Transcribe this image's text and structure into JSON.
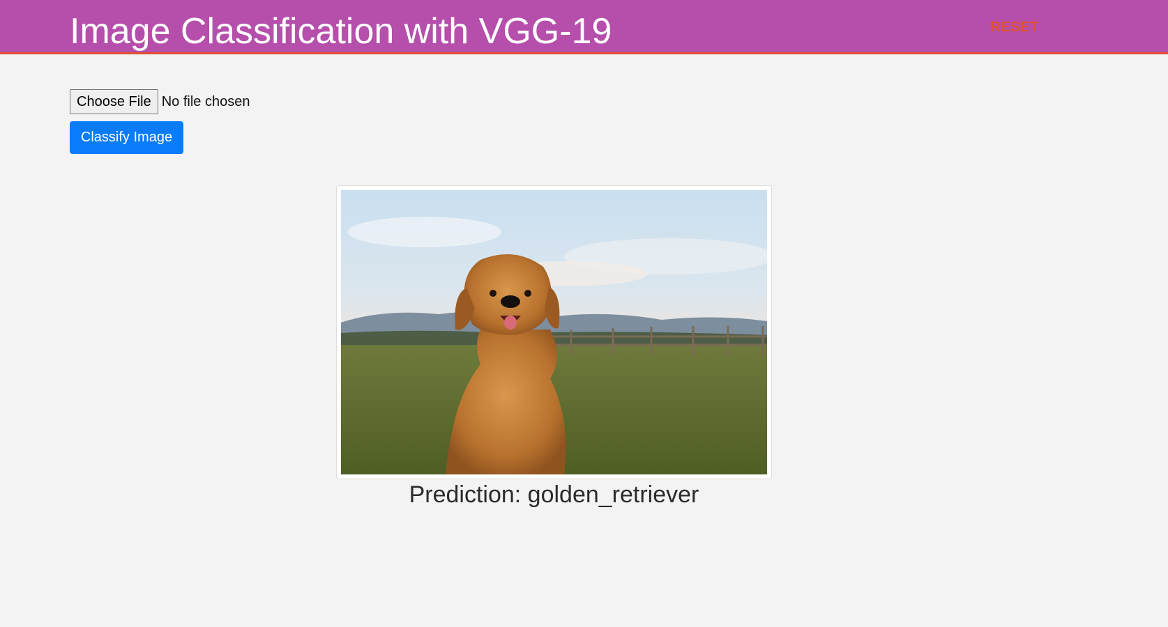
{
  "header": {
    "title": "Image Classification with VGG-19",
    "reset_label": "RESET",
    "background_color": "#b54fab",
    "accent_color": "#e2502d"
  },
  "upload": {
    "choose_file_label": "Choose File",
    "file_status": "No file chosen",
    "classify_label": "Classify Image",
    "classify_color": "#0a7cf9"
  },
  "result": {
    "image_icon": "golden-retriever-photo",
    "prediction_text": "Prediction: golden_retriever"
  }
}
